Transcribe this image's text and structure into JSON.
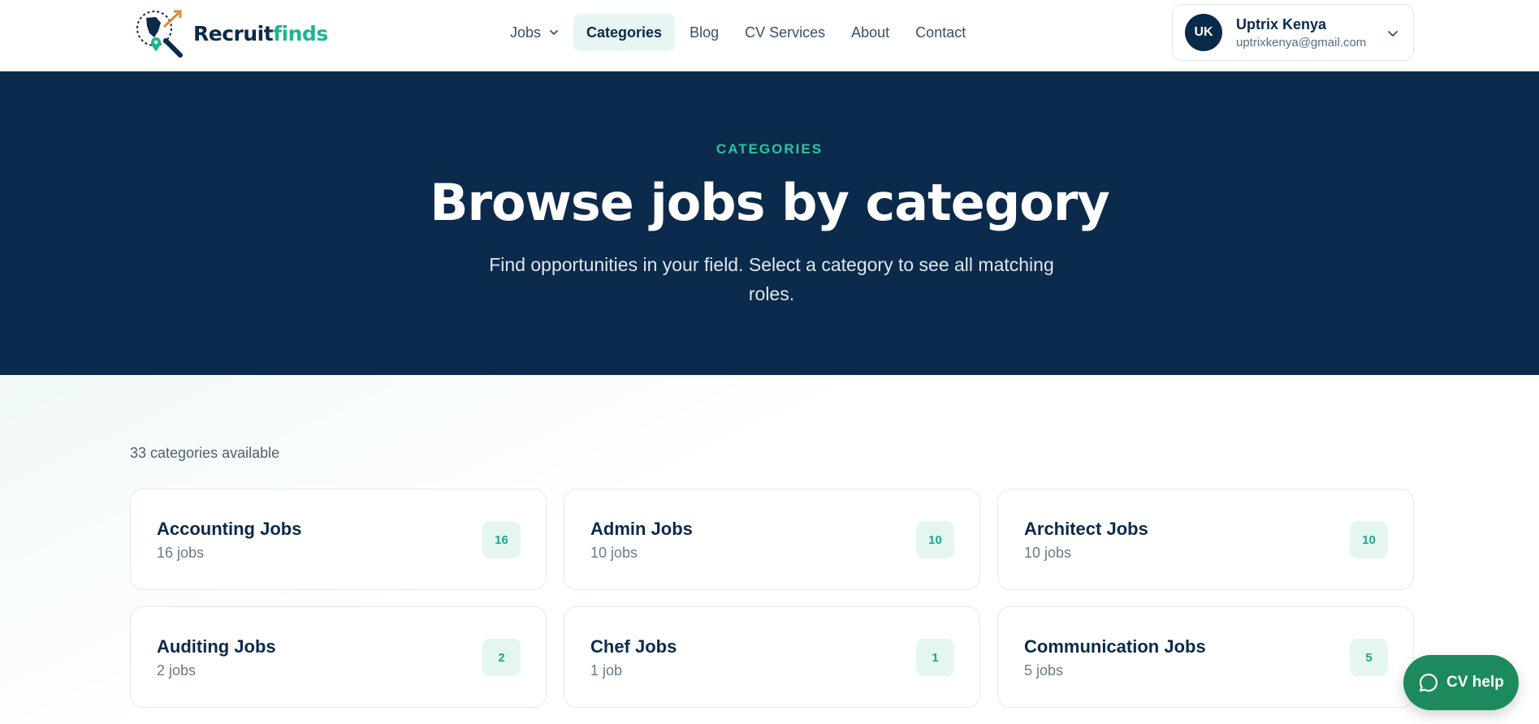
{
  "brand": {
    "name_part1": "Recruit",
    "name_part2": "finds"
  },
  "nav": {
    "items": [
      {
        "label": "Jobs"
      },
      {
        "label": "Categories"
      },
      {
        "label": "Blog"
      },
      {
        "label": "CV Services"
      },
      {
        "label": "About"
      },
      {
        "label": "Contact"
      }
    ]
  },
  "user": {
    "initials": "UK",
    "name": "Uptrix Kenya",
    "email": "uptrixkenya@gmail.com"
  },
  "hero": {
    "eyebrow": "CATEGORIES",
    "title": "Browse jobs by category",
    "subtitle": "Find opportunities in your field. Select a category to see all matching roles."
  },
  "listing": {
    "count_label": "33 categories available",
    "categories": [
      {
        "name": "Accounting Jobs",
        "jobs_label": "16 jobs",
        "count": "16"
      },
      {
        "name": "Admin Jobs",
        "jobs_label": "10 jobs",
        "count": "10"
      },
      {
        "name": "Architect Jobs",
        "jobs_label": "10 jobs",
        "count": "10"
      },
      {
        "name": "Auditing Jobs",
        "jobs_label": "2 jobs",
        "count": "2"
      },
      {
        "name": "Chef Jobs",
        "jobs_label": "1 job",
        "count": "1"
      },
      {
        "name": "Communication Jobs",
        "jobs_label": "5 jobs",
        "count": "5"
      }
    ]
  },
  "cv_help": {
    "label": "CV help"
  },
  "colors": {
    "navy": "#0c2a4b",
    "accent": "#1fb493",
    "cv_button": "#1c8a5d"
  }
}
